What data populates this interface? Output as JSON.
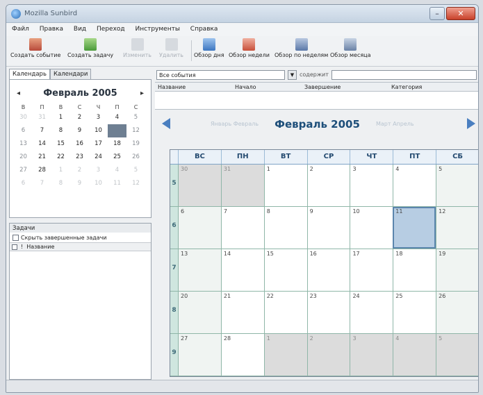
{
  "window": {
    "title": "Mozilla Sunbird"
  },
  "menu": [
    "Файл",
    "Правка",
    "Вид",
    "Переход",
    "Инструменты",
    "Справка"
  ],
  "toolbar": {
    "new_event": "Создать событие",
    "new_task": "Создать задачу",
    "edit": "Изменить",
    "delete": "Удалить",
    "day_view": "Обзор дня",
    "week_view": "Обзор недели",
    "multiweek_view": "Обзор по неделям",
    "month_view": "Обзор месяца"
  },
  "left_tabs": [
    "Календарь",
    "Календари"
  ],
  "minical": {
    "month": "Февраль 2005",
    "prev": "◂",
    "next": "▸",
    "weekdays": [
      "В",
      "П",
      "В",
      "С",
      "Ч",
      "П",
      "С"
    ],
    "weeks": [
      [
        "30",
        "31",
        "1",
        "2",
        "3",
        "4",
        "5"
      ],
      [
        "6",
        "7",
        "8",
        "9",
        "10",
        "11",
        "12"
      ],
      [
        "13",
        "14",
        "15",
        "16",
        "17",
        "18",
        "19"
      ],
      [
        "20",
        "21",
        "22",
        "23",
        "24",
        "25",
        "26"
      ],
      [
        "27",
        "28",
        "1",
        "2",
        "3",
        "4",
        "5"
      ],
      [
        "6",
        "7",
        "8",
        "9",
        "10",
        "11",
        "12"
      ]
    ]
  },
  "tasks": {
    "title": "Задачи",
    "hide_completed": "Скрыть завершенные задачи",
    "col_priority": "!",
    "col_title": "Название"
  },
  "filter": {
    "selected": "Все события",
    "label": "содержит"
  },
  "event_columns": [
    "Название",
    "Начало",
    "Завершение",
    "Категория"
  ],
  "month_view": {
    "title": "Февраль 2005",
    "prev_faint": "Январь Февраль",
    "next_faint": "Март Апрель",
    "weekdays": [
      "ВС",
      "ПН",
      "ВТ",
      "СР",
      "ЧТ",
      "ПТ",
      "СБ"
    ],
    "week_numbers": [
      "5",
      "6",
      "7",
      "8",
      "9"
    ],
    "weeks": [
      [
        "30",
        "31",
        "1",
        "2",
        "3",
        "4",
        "5"
      ],
      [
        "6",
        "7",
        "8",
        "9",
        "10",
        "11",
        "12"
      ],
      [
        "13",
        "14",
        "15",
        "16",
        "17",
        "18",
        "19"
      ],
      [
        "20",
        "21",
        "22",
        "23",
        "24",
        "25",
        "26"
      ],
      [
        "27",
        "28",
        "1",
        "2",
        "3",
        "4",
        "5"
      ]
    ]
  },
  "colors": {
    "accent": "#4a7fc0",
    "today": "#b7cde3",
    "week_strip": "#cfe6df"
  }
}
